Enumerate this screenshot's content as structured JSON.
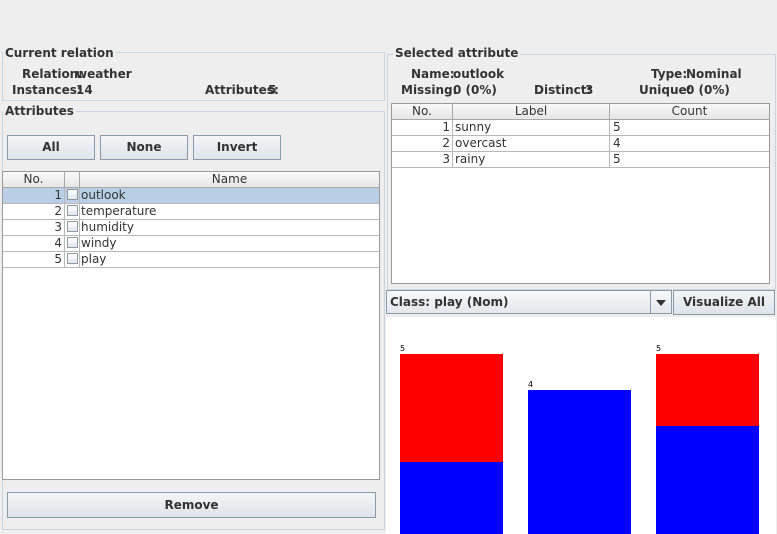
{
  "relation": {
    "section_title": "Current relation",
    "relation_label": "Relation:",
    "relation_value": "weather",
    "instances_label": "Instances:",
    "instances_value": "14",
    "attributes_label": "Attributes:",
    "attributes_value": "5"
  },
  "attributes": {
    "section_title": "Attributes",
    "buttons": {
      "all": "All",
      "none": "None",
      "invert": "Invert",
      "remove": "Remove"
    },
    "columns": [
      "No.",
      "Name"
    ],
    "rows": [
      {
        "no": "1",
        "name": "outlook",
        "selected": true
      },
      {
        "no": "2",
        "name": "temperature",
        "selected": false
      },
      {
        "no": "3",
        "name": "humidity",
        "selected": false
      },
      {
        "no": "4",
        "name": "windy",
        "selected": false
      },
      {
        "no": "5",
        "name": "play",
        "selected": false
      }
    ]
  },
  "selected_attribute": {
    "section_title": "Selected attribute",
    "name_label": "Name:",
    "name_value": "outlook",
    "type_label": "Type:",
    "type_value": "Nominal",
    "missing_label": "Missing:",
    "missing_value": "0 (0%)",
    "distinct_label": "Distinct:",
    "distinct_value": "3",
    "unique_label": "Unique:",
    "unique_value": "0 (0%)",
    "columns": [
      "No.",
      "Label",
      "Count"
    ],
    "rows": [
      {
        "no": "1",
        "label": "sunny",
        "count": "5"
      },
      {
        "no": "2",
        "label": "overcast",
        "count": "4"
      },
      {
        "no": "3",
        "label": "rainy",
        "count": "5"
      }
    ]
  },
  "class_selector": {
    "value": "Class: play (Nom)",
    "visualize_all": "Visualize All"
  },
  "chart_data": {
    "type": "bar",
    "categories": [
      "sunny",
      "overcast",
      "rainy"
    ],
    "totals": [
      5,
      4,
      5
    ],
    "ylim": [
      0,
      5
    ],
    "series": [
      {
        "values": [
          2,
          4,
          3
        ],
        "color": "#0000ff"
      },
      {
        "values": [
          3,
          0,
          2
        ],
        "color": "#ff0000"
      }
    ]
  }
}
